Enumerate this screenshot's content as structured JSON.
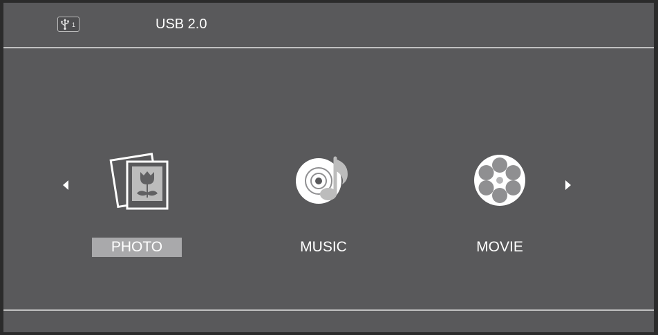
{
  "header": {
    "source_icon": "usb-icon",
    "source_port": "1",
    "title": "USB 2.0"
  },
  "menu": {
    "prev_icon": "triangle-left-icon",
    "next_icon": "triangle-right-icon",
    "selected": "PHOTO",
    "items": [
      {
        "label": "PHOTO",
        "icon": "photo-icon"
      },
      {
        "label": "MUSIC",
        "icon": "music-disc-icon"
      },
      {
        "label": "MOVIE",
        "icon": "film-reel-icon"
      }
    ]
  },
  "colors": {
    "background": "#59595b",
    "rule": "#c2c2c2",
    "selection": "#a9a9ab",
    "text": "#ffffff"
  }
}
